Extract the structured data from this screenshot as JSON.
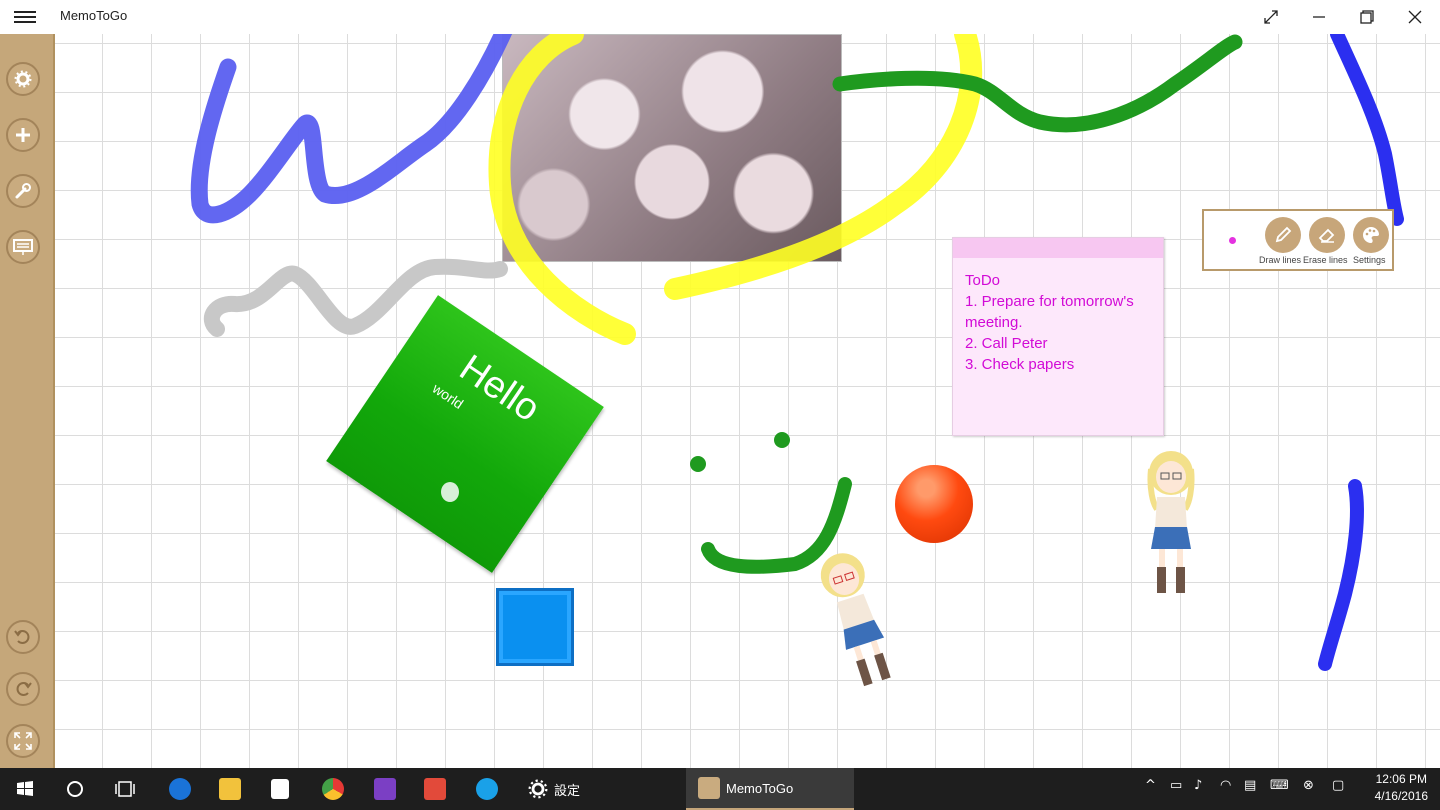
{
  "window": {
    "title": "MemoToGo",
    "buttons": [
      "expand",
      "minimize",
      "restore",
      "close"
    ]
  },
  "sidebar": {
    "top_items": [
      {
        "name": "settings",
        "icon": "gear-icon"
      },
      {
        "name": "add",
        "icon": "plus-icon"
      },
      {
        "name": "tools",
        "icon": "wrench-icon"
      },
      {
        "name": "screen",
        "icon": "board-icon"
      }
    ],
    "bottom_items": [
      {
        "name": "undo",
        "icon": "undo-icon"
      },
      {
        "name": "redo",
        "icon": "redo-icon"
      },
      {
        "name": "fullscreen",
        "icon": "fullscreen-icon"
      }
    ]
  },
  "green_note": {
    "title": "Hello",
    "subtitle": "world"
  },
  "sticky_note": {
    "lines": [
      "ToDo",
      "1. Prepare for tomorrow's meeting.",
      "2. Call Peter",
      "3. Check papers"
    ]
  },
  "pen_panel": {
    "pen_color": "#e432e0",
    "tools": [
      {
        "label": "Draw lines",
        "icon": "pencil-icon"
      },
      {
        "label": "Erase lines",
        "icon": "eraser-icon"
      },
      {
        "label": "Settings",
        "icon": "palette-icon"
      }
    ]
  },
  "taskbar": {
    "apps": [
      {
        "name": "Start",
        "icon": "windows-icon"
      },
      {
        "name": "Cortana",
        "icon": "circle-icon"
      },
      {
        "name": "Task View",
        "icon": "taskview-icon"
      },
      {
        "name": "Edge",
        "icon": "edge-icon"
      },
      {
        "name": "File Explorer",
        "icon": "folder-icon"
      },
      {
        "name": "Store",
        "icon": "store-icon"
      },
      {
        "name": "Chrome",
        "icon": "chrome-icon"
      },
      {
        "name": "Visual Studio",
        "icon": "visualstudio-icon"
      },
      {
        "name": "Paint",
        "icon": "paint-icon"
      },
      {
        "name": "Internet Explorer",
        "icon": "ie-icon"
      }
    ],
    "settings_label": "設定",
    "active_app_label": "MemoToGo",
    "time": "12:06 PM",
    "date": "4/16/2016"
  },
  "colors": {
    "sidebar": "#c5a77a",
    "sticky_text": "#d20ad6",
    "green_note": "#12a80a",
    "orange_ball": "#ff4a10",
    "blue_square": "#0a90f0"
  }
}
